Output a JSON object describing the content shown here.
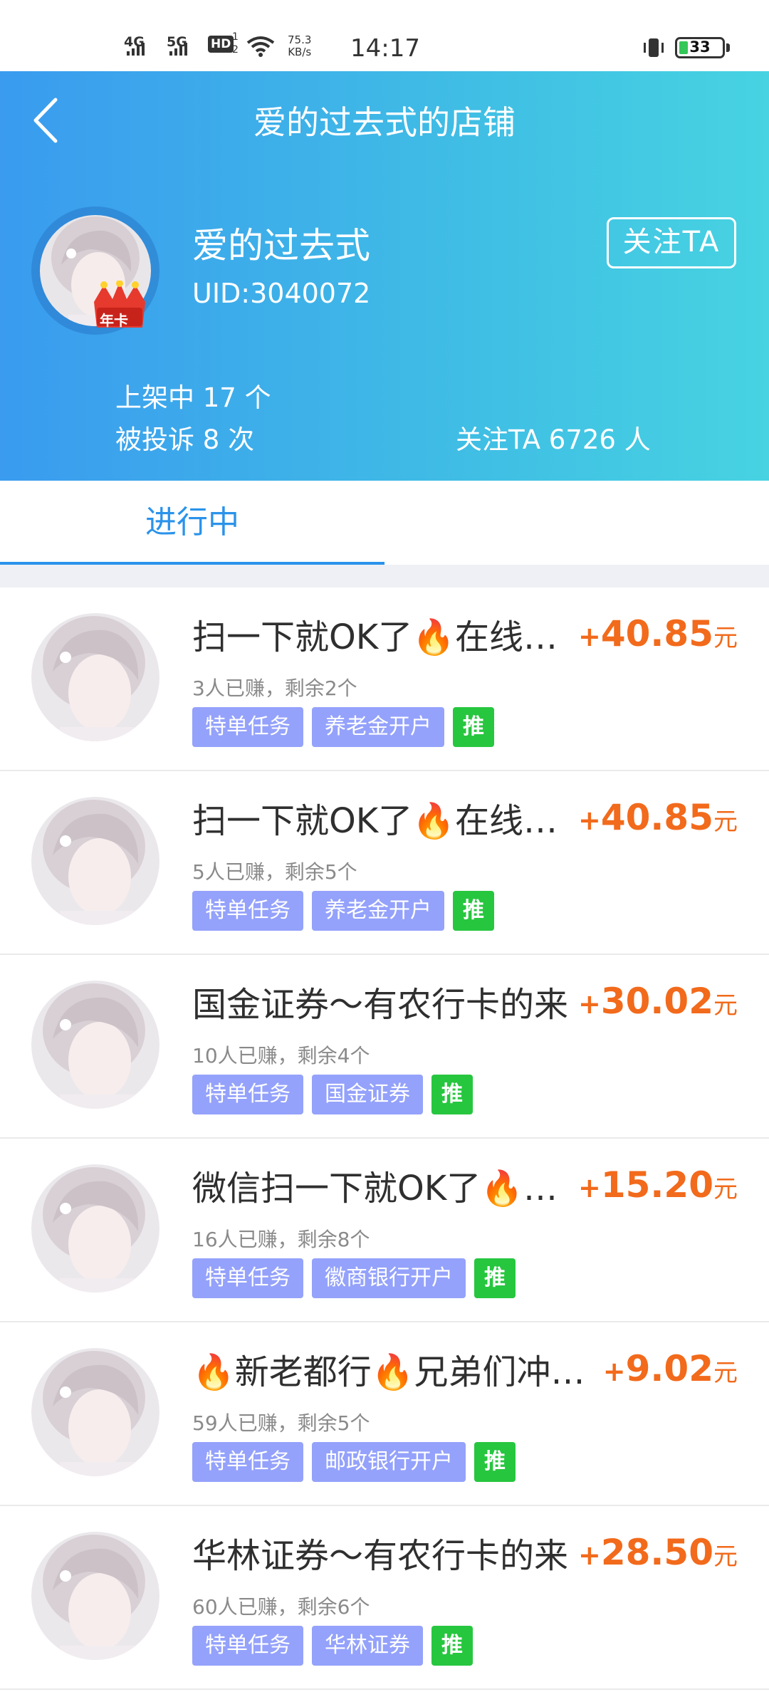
{
  "status_bar": {
    "net1": "4G",
    "net2": "5G",
    "hd": "HD",
    "hd_num": "1",
    "hd_num2": "2",
    "speed_value": "75.3",
    "speed_unit": "KB/s",
    "time": "14:17",
    "battery": "33"
  },
  "header": {
    "title": "爱的过去式的店铺",
    "user_name": "爱的过去式",
    "uid": "UID:3040072",
    "badge": "年卡",
    "follow_label": "关注TA",
    "listed": "上架中 17 个",
    "complaints": "被投诉 8 次",
    "followers": "关注TA 6726 人"
  },
  "tabs": {
    "active": "进行中"
  },
  "tasks": [
    {
      "title": "扫一下就OK了🔥在线…",
      "sub": "3人已赚，剩余2个",
      "tag1": "特单任务",
      "tag2": "养老金开户",
      "push": "推",
      "plus": "+",
      "amount": "40.85",
      "unit": "元"
    },
    {
      "title": "扫一下就OK了🔥在线…",
      "sub": "5人已赚，剩余5个",
      "tag1": "特单任务",
      "tag2": "养老金开户",
      "push": "推",
      "plus": "+",
      "amount": "40.85",
      "unit": "元"
    },
    {
      "title": "国金证券～有农行卡的来",
      "sub": "10人已赚，剩余4个",
      "tag1": "特单任务",
      "tag2": "国金证券",
      "push": "推",
      "plus": "+",
      "amount": "30.02",
      "unit": "元"
    },
    {
      "title": "微信扫一下就OK了🔥…",
      "sub": "16人已赚，剩余8个",
      "tag1": "特单任务",
      "tag2": "徽商银行开户",
      "push": "推",
      "plus": "+",
      "amount": "15.20",
      "unit": "元"
    },
    {
      "title": "🔥新老都行🔥兄弟们冲…",
      "sub": "59人已赚，剩余5个",
      "tag1": "特单任务",
      "tag2": "邮政银行开户",
      "push": "推",
      "plus": "+",
      "amount": "9.02",
      "unit": "元"
    },
    {
      "title": "华林证券～有农行卡的来",
      "sub": "60人已赚，剩余6个",
      "tag1": "特单任务",
      "tag2": "华林证券",
      "push": "推",
      "plus": "+",
      "amount": "28.50",
      "unit": "元"
    }
  ],
  "colors": {
    "accent": "#2a93ea",
    "reward": "#f26a1b",
    "tag": "#94a2fb",
    "push": "#27c63f"
  }
}
